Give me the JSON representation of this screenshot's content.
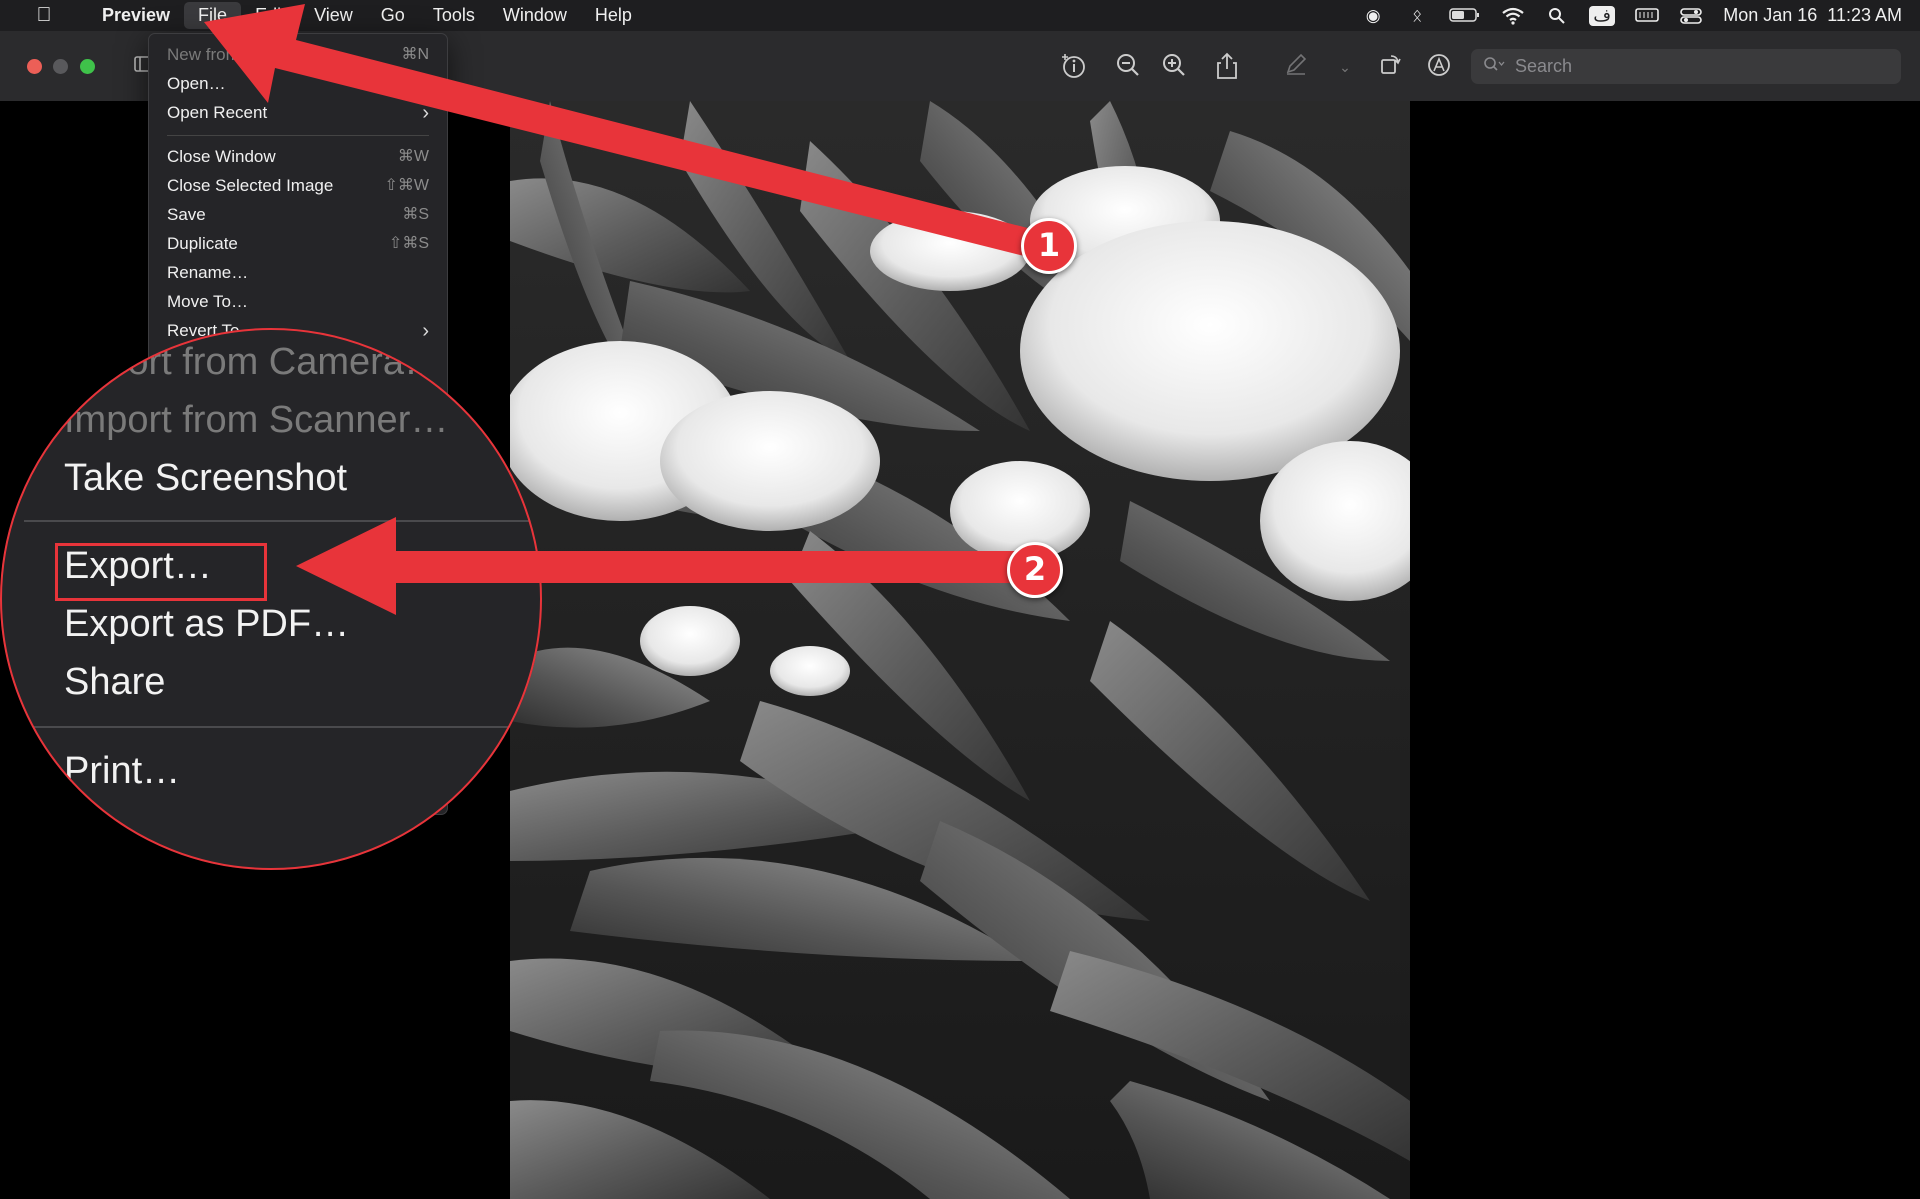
{
  "menubar": {
    "app_name": "Preview",
    "items": [
      "File",
      "Edit",
      "View",
      "Go",
      "Tools",
      "Window",
      "Help"
    ],
    "active_item": "File",
    "clock": "Mon Jan 16  11:23 AM"
  },
  "toolbar": {
    "search_placeholder": "Search",
    "icons": [
      "sidebar-icon",
      "info-icon",
      "zoom-out-icon",
      "zoom-in-icon",
      "share-icon",
      "markup-pen-icon",
      "rotate-icon",
      "annotate-icon"
    ]
  },
  "file_menu": {
    "items": [
      {
        "label": "New from Clipboard",
        "shortcut": "⌘N",
        "dim": true
      },
      {
        "label": "Open…",
        "shortcut": ""
      },
      {
        "label": "Open Recent",
        "shortcut": "›"
      },
      {
        "label": "Close Window",
        "shortcut": "⌘W"
      },
      {
        "label": "Close Selected Image",
        "shortcut": "⇧⌘W"
      },
      {
        "label": "Save",
        "shortcut": "⌘S"
      },
      {
        "label": "Duplicate",
        "shortcut": "⇧⌘S"
      },
      {
        "label": "Rename…",
        "shortcut": ""
      },
      {
        "label": "Move To…",
        "shortcut": ""
      },
      {
        "label": "Revert To",
        "shortcut": "›"
      }
    ]
  },
  "zoomed_menu": {
    "import_camera": "Import from Camera…",
    "import_scanner": "Import from Scanner…",
    "take_screenshot": "Take Screenshot",
    "export": "Export…",
    "export_pdf": "Export as PDF…",
    "share": "Share",
    "print": "Print…"
  },
  "annotations": {
    "step1": "1",
    "step2": "2",
    "color": "#e8343a"
  }
}
